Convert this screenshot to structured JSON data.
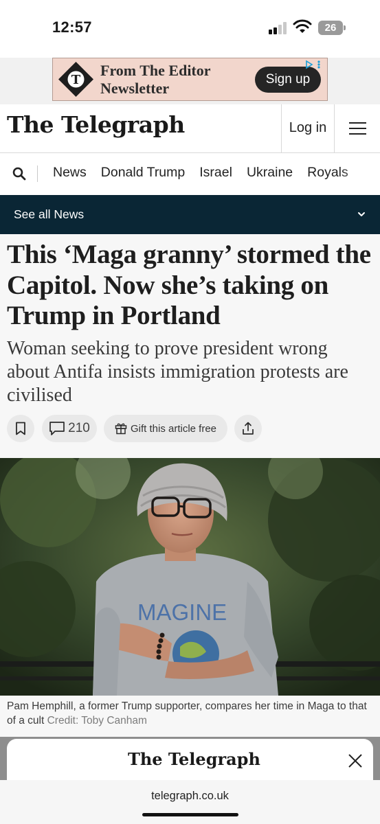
{
  "status_bar": {
    "time": "12:57",
    "battery": "26"
  },
  "ad": {
    "headline": "From The Editor Newsletter",
    "button": "Sign up",
    "brand_color": "#f2d6cc"
  },
  "masthead": {
    "brand": "The Telegraph",
    "login": "Log in"
  },
  "nav": {
    "items": [
      "News",
      "Donald Trump",
      "Israel",
      "Ukraine",
      "Royals"
    ]
  },
  "section_bar": {
    "label": "See all News",
    "color": "#0a2635"
  },
  "article": {
    "headline": "This ‘Maga granny’ stormed the Capitol. Now she’s taking on Trump in Portland",
    "standfirst": "Woman seeking to prove president wrong about Antifa insists immigration protests are civilised",
    "comments_count": "210",
    "gift_label": "Gift this article free",
    "photo_shirt_text": "MAGINE",
    "caption": "Pam Hemphill, a former Trump supporter, compares her time in Maga to that of a cult",
    "credit": "Credit: Toby Canham"
  },
  "bottom_sheet": {
    "brand": "The Telegraph"
  },
  "browser": {
    "url": "telegraph.co.uk"
  },
  "icons": [
    "signal-icon",
    "wifi-icon",
    "battery-icon",
    "search-icon",
    "menu-icon",
    "chevron-down-icon",
    "bookmark-icon",
    "comment-icon",
    "gift-icon",
    "share-icon",
    "close-icon",
    "adchoices-icon"
  ]
}
